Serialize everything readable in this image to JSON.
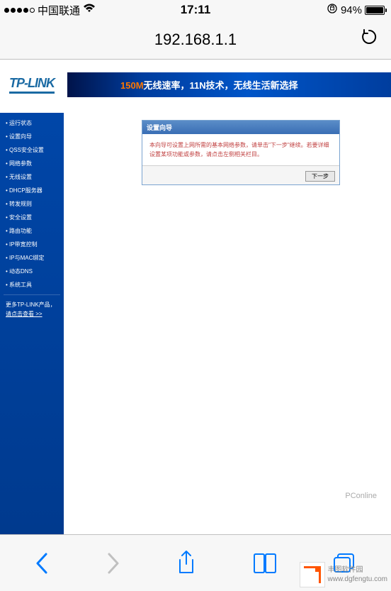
{
  "status": {
    "carrier": "中国联通",
    "time": "17:11",
    "battery_pct": "94%"
  },
  "browser": {
    "url": "192.168.1.1"
  },
  "banner": {
    "logo": "TP-LINK",
    "slogan_highlight": "150M",
    "slogan_rest": "无线速率，11N技术，无线生活新选择"
  },
  "sidebar": {
    "items": [
      "运行状态",
      "设置向导",
      "QSS安全设置",
      "网络参数",
      "无线设置",
      "DHCP服务器",
      "转发规则",
      "安全设置",
      "路由功能",
      "IP带宽控制",
      "IP与MAC绑定",
      "动态DNS",
      "系统工具"
    ],
    "more_line1": "更多TP-LINK产品，",
    "more_line2": "请点击查看 >>"
  },
  "panel": {
    "title": "设置向导",
    "body": "本向导可设置上网所需的基本网络参数，请单击\"下一步\"继续。若要详细设置某项功能或参数，请点击左侧相关栏目。",
    "next_button": "下一步"
  },
  "watermark": {
    "pconline": "PConline",
    "brand": "丰图软件园",
    "url": "www.dgfengtu.com"
  }
}
